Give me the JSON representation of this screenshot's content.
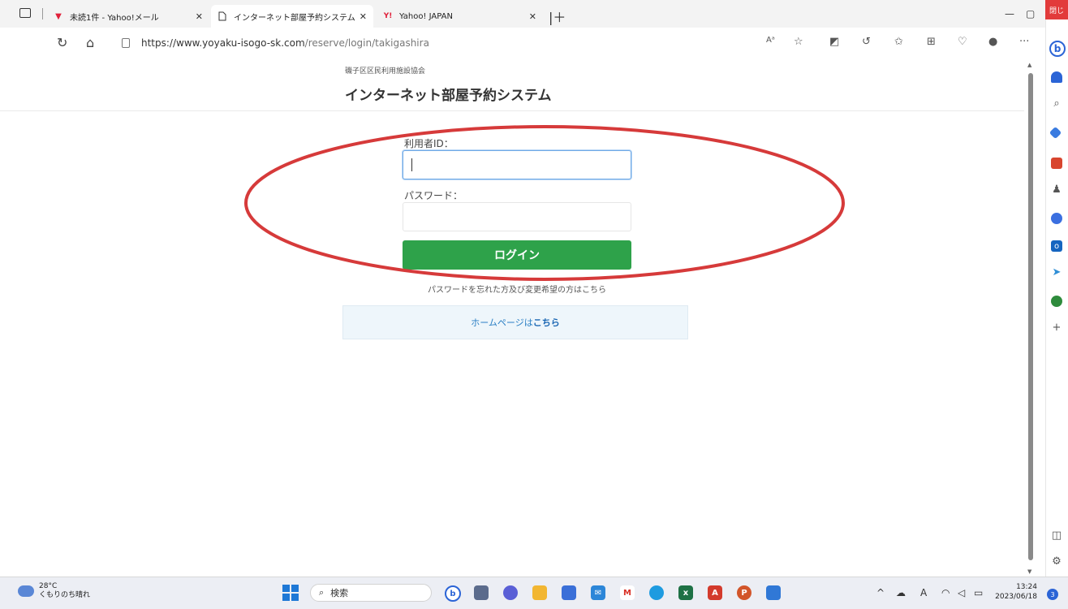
{
  "browser": {
    "tabs": [
      {
        "title": "未読1件 - Yahoo!メール",
        "active": false
      },
      {
        "title": "インターネット部屋予約システム",
        "active": true
      },
      {
        "title": "Yahoo! JAPAN",
        "active": false
      }
    ],
    "url_host": "https://www.yoyaku-isogo-sk.com",
    "url_path": "/reserve/login/takigashira",
    "close_tooltip": "閉じ",
    "more_label": "···"
  },
  "page": {
    "org_name": "磯子区区民利用施設協会",
    "system_title": "インターネット部屋予約システム",
    "user_id_label": "利用者ID：",
    "user_id_value": "",
    "password_label": "パスワード：",
    "password_value": "",
    "login_button": "ログイン",
    "forgot_link": "パスワードを忘れた方及び変更希望の方はこちら",
    "homepage_prefix": "ホームページは",
    "homepage_link": "こちら",
    "annotation_color": "#d63a3a"
  },
  "taskbar": {
    "weather_temp": "28°C",
    "weather_desc": "くもりのち晴れ",
    "search_label": "検索",
    "time": "13:24",
    "date": "2023/06/18",
    "ime_label": "A"
  }
}
